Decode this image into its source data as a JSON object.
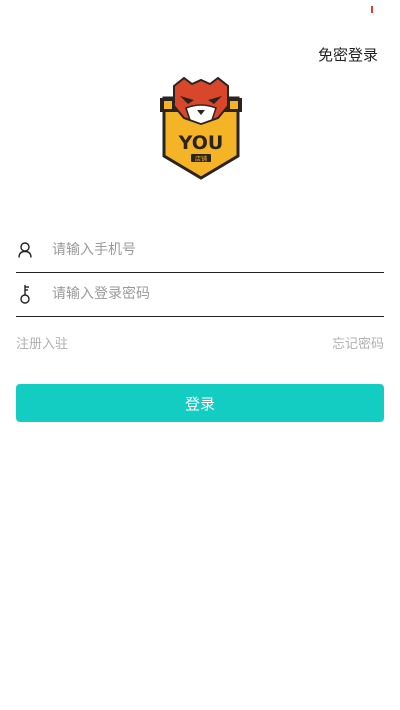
{
  "header": {
    "passwordless_login_label": "免密登录"
  },
  "logo": {
    "wordmark": "YOU",
    "subtext": "店铺",
    "icon": "tiger-mascot-logo"
  },
  "form": {
    "phone": {
      "icon": "user-icon",
      "value": "",
      "placeholder": "请输入手机号"
    },
    "password": {
      "icon": "key-icon",
      "value": "",
      "placeholder": "请输入登录密码"
    }
  },
  "links": {
    "register_label": "注册入驻",
    "forgot_password_label": "忘记密码"
  },
  "actions": {
    "login_label": "登录"
  },
  "colors": {
    "accent": "#14cdc2",
    "logo_yellow": "#f5b326",
    "logo_red": "#d9472b"
  }
}
